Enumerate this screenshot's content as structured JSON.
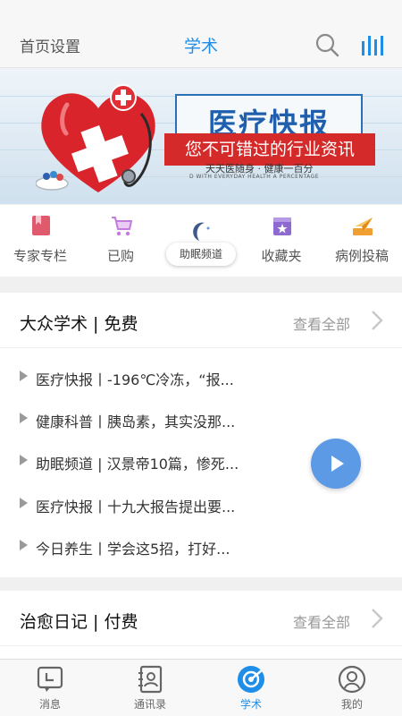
{
  "header": {
    "left_label": "首页设置",
    "title": "学术",
    "icons": [
      "search-icon",
      "bars-icon"
    ]
  },
  "banner": {
    "title": "医疗快报",
    "tagline": "您不可错过的行业资讯",
    "motto_cn": "天天医随身 · 健康一百分",
    "motto_en": "D WITH EVERYDAY HEALTH A PERCENTAGE"
  },
  "shortcuts": [
    {
      "label": "专家专栏",
      "icon": "book-icon",
      "color": "#e05a6e"
    },
    {
      "label": "已购",
      "icon": "cart-icon",
      "color": "#c57ae0"
    },
    {
      "label": "助眠频道",
      "icon": "moon-icon",
      "color": "#3d5a8a"
    },
    {
      "label": "收藏夹",
      "icon": "star-folder-icon",
      "color": "#8e6ad0"
    },
    {
      "label": "病例投稿",
      "icon": "paper-plane-icon",
      "color": "#f0a030"
    }
  ],
  "sections": [
    {
      "title": "大众学术 | 免费",
      "more": "查看全部",
      "items": [
        "医疗快报丨-196℃冷冻，“报...",
        "健康科普丨胰岛素，其实没那...",
        "助眠频道 | 汉景帝10篇，惨死...",
        "医疗快报丨十九大报告提出要...",
        "今日养生丨学会这5招，打好..."
      ]
    },
    {
      "title": "治愈日记 | 付费",
      "more": "查看全部",
      "items": []
    }
  ],
  "tabs": [
    {
      "label": "消息",
      "icon": "message-icon",
      "active": false
    },
    {
      "label": "通讯录",
      "icon": "contacts-icon",
      "active": false
    },
    {
      "label": "学术",
      "icon": "academic-icon",
      "active": true
    },
    {
      "label": "我的",
      "icon": "profile-icon",
      "active": false
    }
  ],
  "colors": {
    "accent": "#1e8ee8",
    "fab": "#5c9ae6",
    "banner_red": "#d42a2a",
    "banner_blue": "#1f5fae"
  }
}
